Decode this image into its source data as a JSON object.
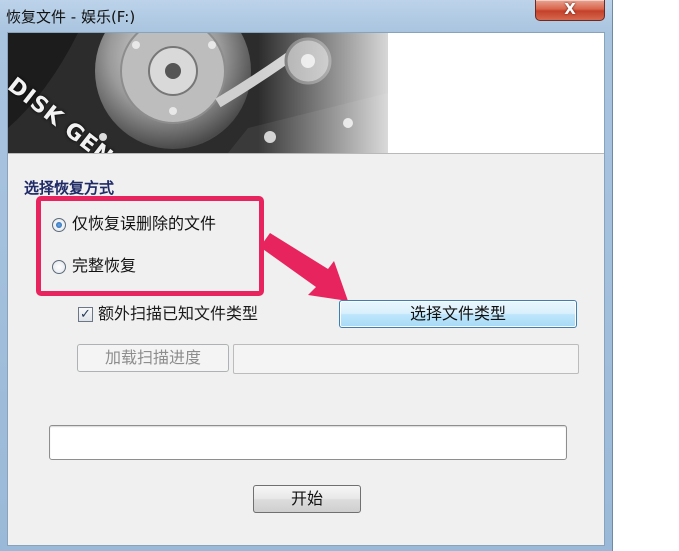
{
  "window": {
    "title": "恢复文件 - 娱乐(F:)",
    "close_label": "X"
  },
  "banner": {
    "brand": "DISK GENIUS"
  },
  "recovery": {
    "group_title": "选择恢复方式",
    "options": [
      {
        "label": "仅恢复误删除的文件",
        "selected": true
      },
      {
        "label": "完整恢复",
        "selected": false
      }
    ]
  },
  "scan": {
    "extra_scan_label": "额外扫描已知文件类型",
    "extra_scan_checked": true,
    "select_types_label": "选择文件类型",
    "load_progress_label": "加载扫描进度",
    "load_progress_path": ""
  },
  "actions": {
    "start_label": "开始"
  },
  "colors": {
    "highlight": "#e8245e",
    "arrow": "#e8245e",
    "primary_button": "#bee6fd"
  }
}
